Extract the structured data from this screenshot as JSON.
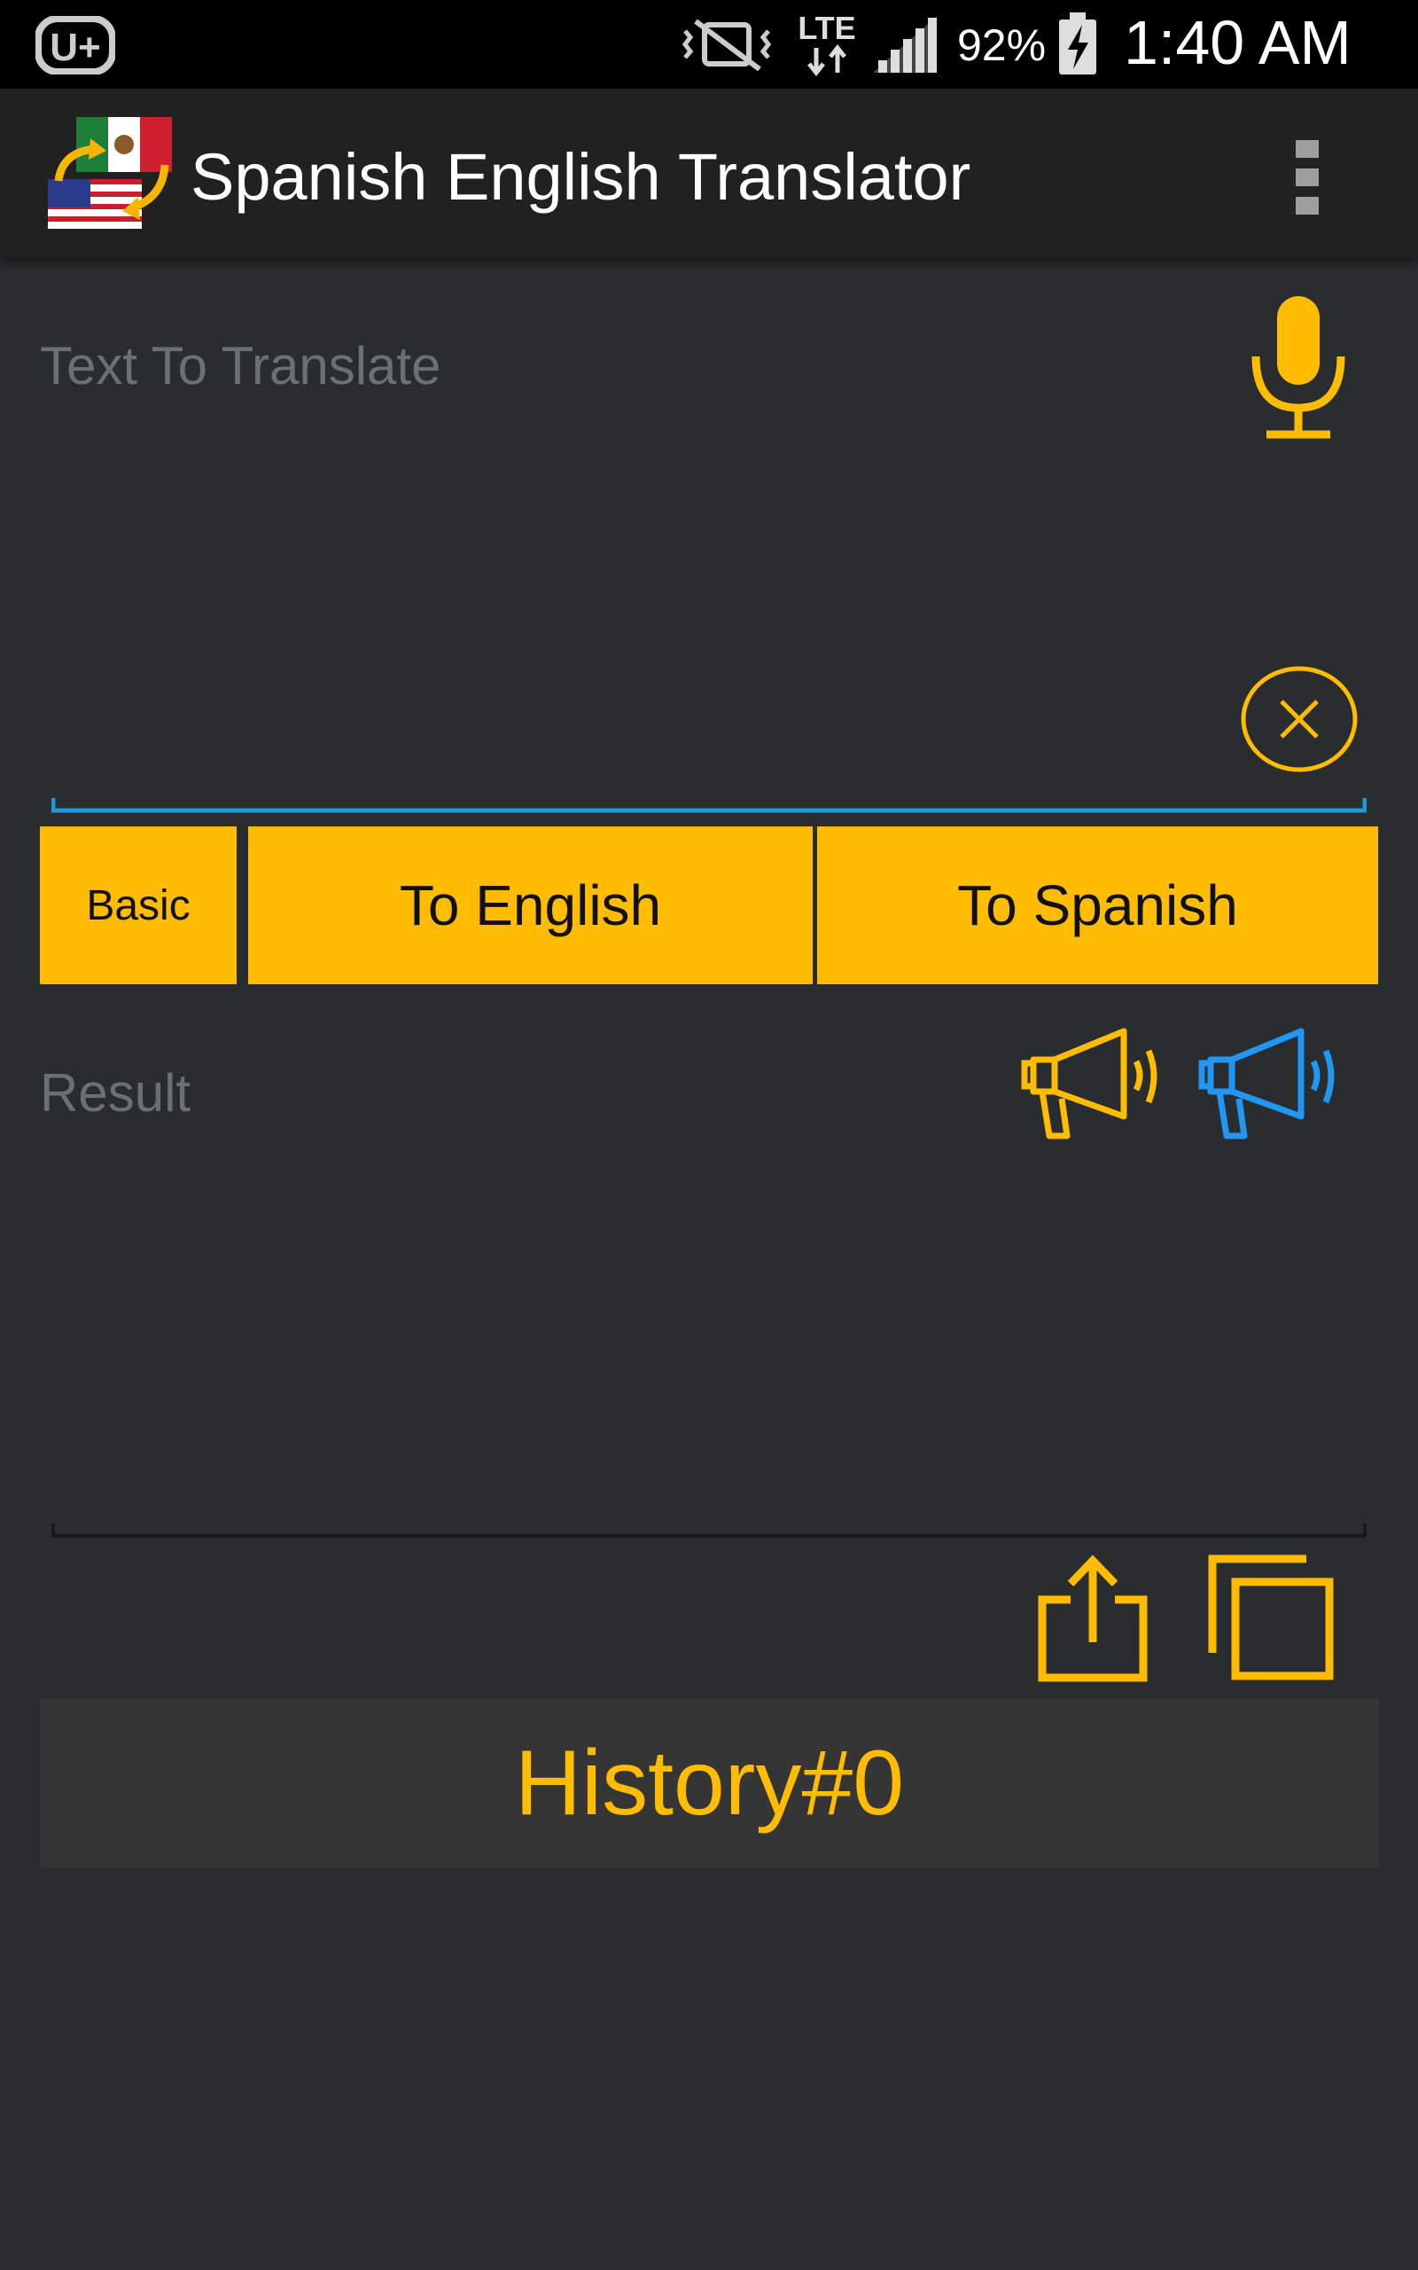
{
  "status_bar": {
    "battery_percent": "92%",
    "time": "1:40 AM",
    "network": "LTE",
    "icons": [
      "carrier-logo-icon",
      "vibrate-off-icon",
      "lte-data-icon",
      "signal-icon",
      "battery-charging-icon"
    ]
  },
  "app_bar": {
    "title": "Spanish English Translator",
    "icons": [
      "app-logo-flags-icon",
      "overflow-menu-icon"
    ]
  },
  "input": {
    "placeholder": "Text To Translate",
    "value": ""
  },
  "buttons": {
    "basic": "Basic",
    "to_english": "To English",
    "to_spanish": "To Spanish"
  },
  "result": {
    "placeholder": "Result",
    "value": ""
  },
  "history": {
    "label": "History#0"
  },
  "colors": {
    "accent": "#ffbc00",
    "accent_blue": "#2196f3",
    "background": "#2a2d2f",
    "app_bar": "#212121",
    "input_underline": "#1e9bd6"
  }
}
